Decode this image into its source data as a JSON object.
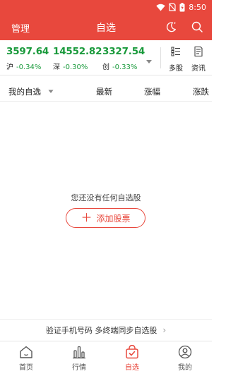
{
  "status_bar": {
    "time": "8:50"
  },
  "app_bar": {
    "manage": "管理",
    "title": "自选"
  },
  "indices": [
    {
      "value": "3597.64",
      "name": "沪",
      "change": "-0.34%"
    },
    {
      "value": "14552.82",
      "name": "深",
      "change": "-0.30%"
    },
    {
      "value": "3327.54",
      "name": "创",
      "change": "-0.33%"
    }
  ],
  "tools": {
    "multi_stock": "多股",
    "news": "资讯"
  },
  "columns": {
    "mine": "我的自选",
    "latest": "最新",
    "change": "涨幅",
    "rise": "涨跌"
  },
  "empty": {
    "message": "您还没有任何自选股",
    "add_button": "添加股票"
  },
  "sync": {
    "text": "验证手机号码 多终端同步自选股"
  },
  "tabs": [
    {
      "label": "首页",
      "icon": "home-icon"
    },
    {
      "label": "行情",
      "icon": "bar-chart-icon"
    },
    {
      "label": "自选",
      "icon": "favorites-bag-icon"
    },
    {
      "label": "我的",
      "icon": "user-icon"
    }
  ],
  "colors": {
    "brand": "#e8483d",
    "down": "#1a9a3c"
  }
}
